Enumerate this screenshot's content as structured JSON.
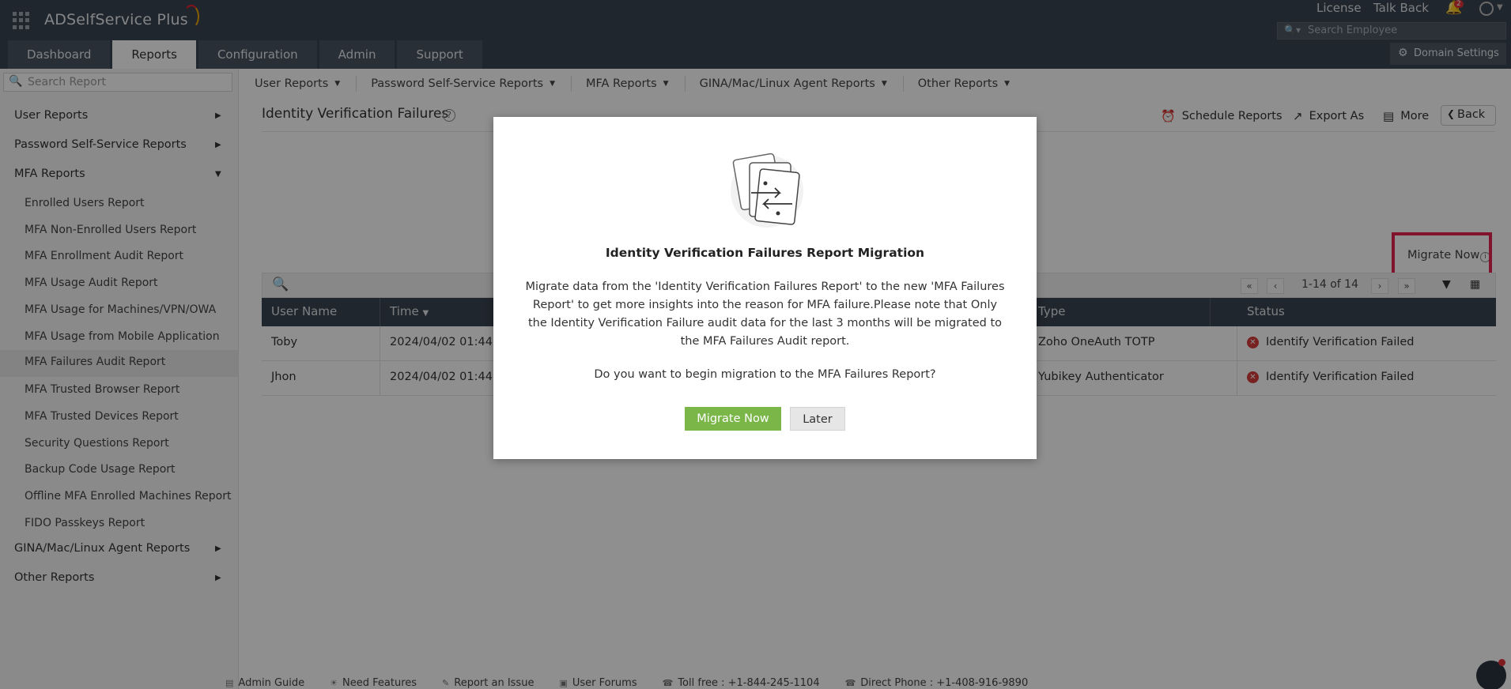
{
  "app": {
    "name": "ADSelfService Plus"
  },
  "header": {
    "license": "License",
    "talk_back": "Talk Back",
    "notification_count": "2",
    "search_placeholder": "Search Employee",
    "domain_settings": "Domain Settings",
    "tabs": [
      "Dashboard",
      "Reports",
      "Configuration",
      "Admin",
      "Support"
    ],
    "active_tab": "Reports"
  },
  "sidebar": {
    "search_placeholder": "Search Report",
    "categories": [
      "User Reports",
      "Password Self-Service Reports",
      "MFA Reports",
      "GINA/Mac/Linux Agent Reports",
      "Other Reports"
    ],
    "mfa_items": [
      "Enrolled Users Report",
      "MFA Non-Enrolled Users Report",
      "MFA Enrollment Audit Report",
      "MFA Usage Audit Report",
      "MFA Usage for Machines/VPN/OWA",
      "MFA Usage from Mobile Application",
      "MFA Failures Audit Report",
      "MFA Trusted Browser Report",
      "MFA Trusted Devices Report",
      "Security Questions Report",
      "Backup Code Usage Report",
      "Offline MFA Enrolled Machines Report",
      "FIDO Passkeys Report"
    ],
    "selected_item": "MFA Failures Audit Report"
  },
  "subnav": [
    "User Reports",
    "Password Self-Service Reports",
    "MFA Reports",
    "GINA/Mac/Linux Agent Reports",
    "Other Reports"
  ],
  "report": {
    "title": "Identity Verification Failures",
    "actions": {
      "schedule": "Schedule Reports",
      "export": "Export As",
      "more": "More",
      "back": "Back"
    },
    "migrate_now": "Migrate Now",
    "pagination": "1-14 of 14",
    "columns": [
      "User Name",
      "Time",
      "Type",
      "Status"
    ],
    "rows": [
      {
        "user": "Toby",
        "time": "2024/04/02 01:44",
        "type": "Zoho OneAuth TOTP",
        "status": "Identify Verification Failed"
      },
      {
        "user": "Jhon",
        "time": "2024/04/02 01:44",
        "type": "Yubikey Authenticator",
        "status": "Identify Verification Failed"
      }
    ]
  },
  "footer": [
    "Admin Guide",
    "Need Features",
    "Report an Issue",
    "User Forums",
    "Toll free : +1-844-245-1104",
    "Direct Phone : +1-408-916-9890"
  ],
  "modal": {
    "title": "Identity Verification Failures Report Migration",
    "body": "Migrate data from the 'Identity Verification Failures Report' to the new 'MFA Failures Report' to get more insights into the reason for MFA failure.Please note that Only the Identity Verification Failure audit data for the last 3 months will be migrated to the MFA Failures Audit report.",
    "question": "Do you want to begin migration to the MFA Failures Report?",
    "primary_button": "Migrate Now",
    "secondary_button": "Later"
  },
  "colors": {
    "header_bg": "#3a4450",
    "accent_green": "#7ab648",
    "highlight_red": "#e8224f",
    "error_red": "#d63c3c"
  }
}
